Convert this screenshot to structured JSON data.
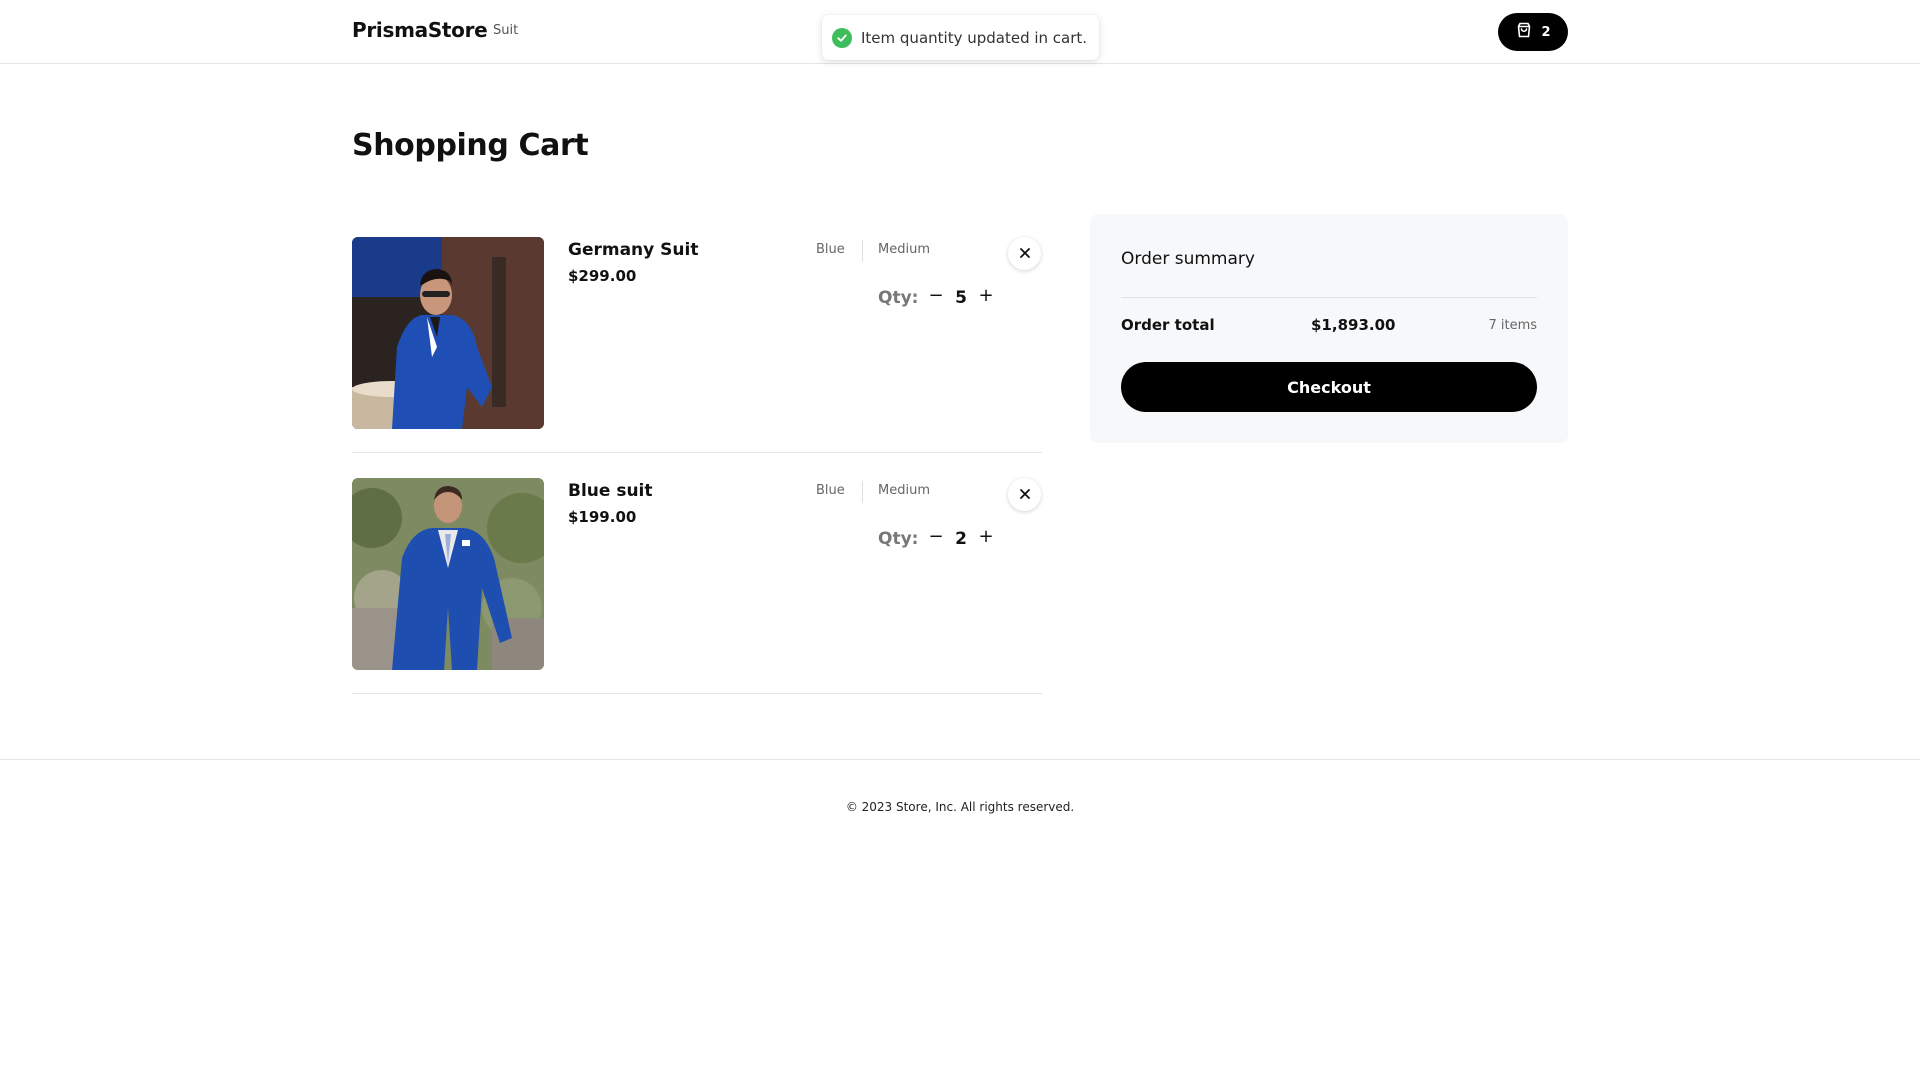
{
  "header": {
    "brand": "PrismaStore",
    "nav_link": "Suit",
    "cart_count": "2",
    "cart_icon": "shopping-bag-icon"
  },
  "toast": {
    "message": "Item quantity updated in cart.",
    "icon": "check-circle-icon",
    "icon_color": "#3ebd5c"
  },
  "page_title": "Shopping Cart",
  "cart": {
    "items": [
      {
        "name": "Germany Suit",
        "price": "$299.00",
        "color": "Blue",
        "size": "Medium",
        "qty_label": "Qty:",
        "qty": "5",
        "minus": "−",
        "plus": "+"
      },
      {
        "name": "Blue suit",
        "price": "$199.00",
        "color": "Blue",
        "size": "Medium",
        "qty_label": "Qty:",
        "qty": "2",
        "minus": "−",
        "plus": "+"
      }
    ]
  },
  "summary": {
    "title": "Order summary",
    "total_label": "Order total",
    "total_amount": "$1,893.00",
    "items_count": "7 items",
    "checkout_label": "Checkout"
  },
  "footer": {
    "copyright": "© 2023 Store, Inc. All rights reserved."
  },
  "colors": {
    "accent": "#000000",
    "summary_bg": "#f7f8fa",
    "suit_blue": "#1e4fb0"
  }
}
